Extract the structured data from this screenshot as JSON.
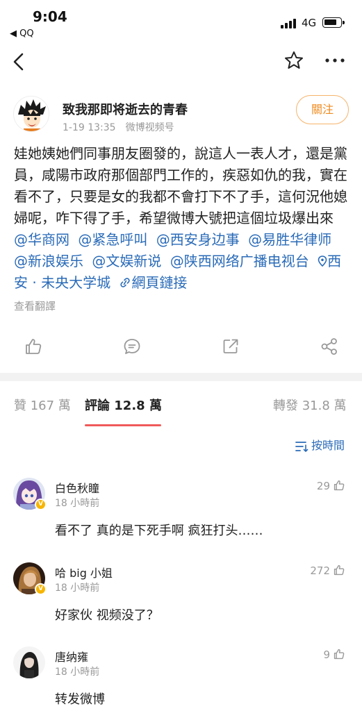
{
  "status_bar": {
    "time": "9:04",
    "back_app": "◀ QQ",
    "network": "4G"
  },
  "post": {
    "author": "致我那即将逝去的青春",
    "date": "1-19 13:35",
    "source": "微博视频号",
    "follow_label": "關注",
    "text": "娃她姨她們同事朋友圈發的，說這人一表人才，還是黨員，咸陽市政府那個部門工作的，疾惡如仇的我，實在看不了，只要是女的我都不會打下不了手，這何況他媳婦呢，咋下得了手，希望微博大號把這個垃圾爆出來",
    "mentions": [
      "@华商网",
      "@紧急呼叫",
      "@西安身边事",
      "@易胜华律师",
      "@新浪娱乐",
      "@文娱新说",
      "@陕西网络广播电视台"
    ],
    "location": "西安 · 未央大学城",
    "link_label": "網頁鏈接",
    "translate_label": "查看翻譯"
  },
  "tabs": {
    "likes": "贊 167 萬",
    "comments": "評論 12.8 萬",
    "reposts": "轉發 31.8 萬"
  },
  "sort_label": "按時間",
  "comments": [
    {
      "name": "白色秋瞳",
      "time": "18 小時前",
      "likes": "29",
      "text": "看不了 真的是下死手啊 疯狂打头……",
      "verified": true
    },
    {
      "name": "哈 big 小姐",
      "time": "18 小時前",
      "likes": "272",
      "text": "好家伙 视频没了？",
      "verified": true
    },
    {
      "name": "唐纳雍",
      "time": "18 小時前",
      "likes": "9",
      "text": "转发微博",
      "verified": false
    }
  ],
  "colors": {
    "link": "#2a6bb8",
    "follow": "#f08a1e",
    "tab_indicator": "#f05a5a",
    "verified_badge": "#f7b500"
  }
}
